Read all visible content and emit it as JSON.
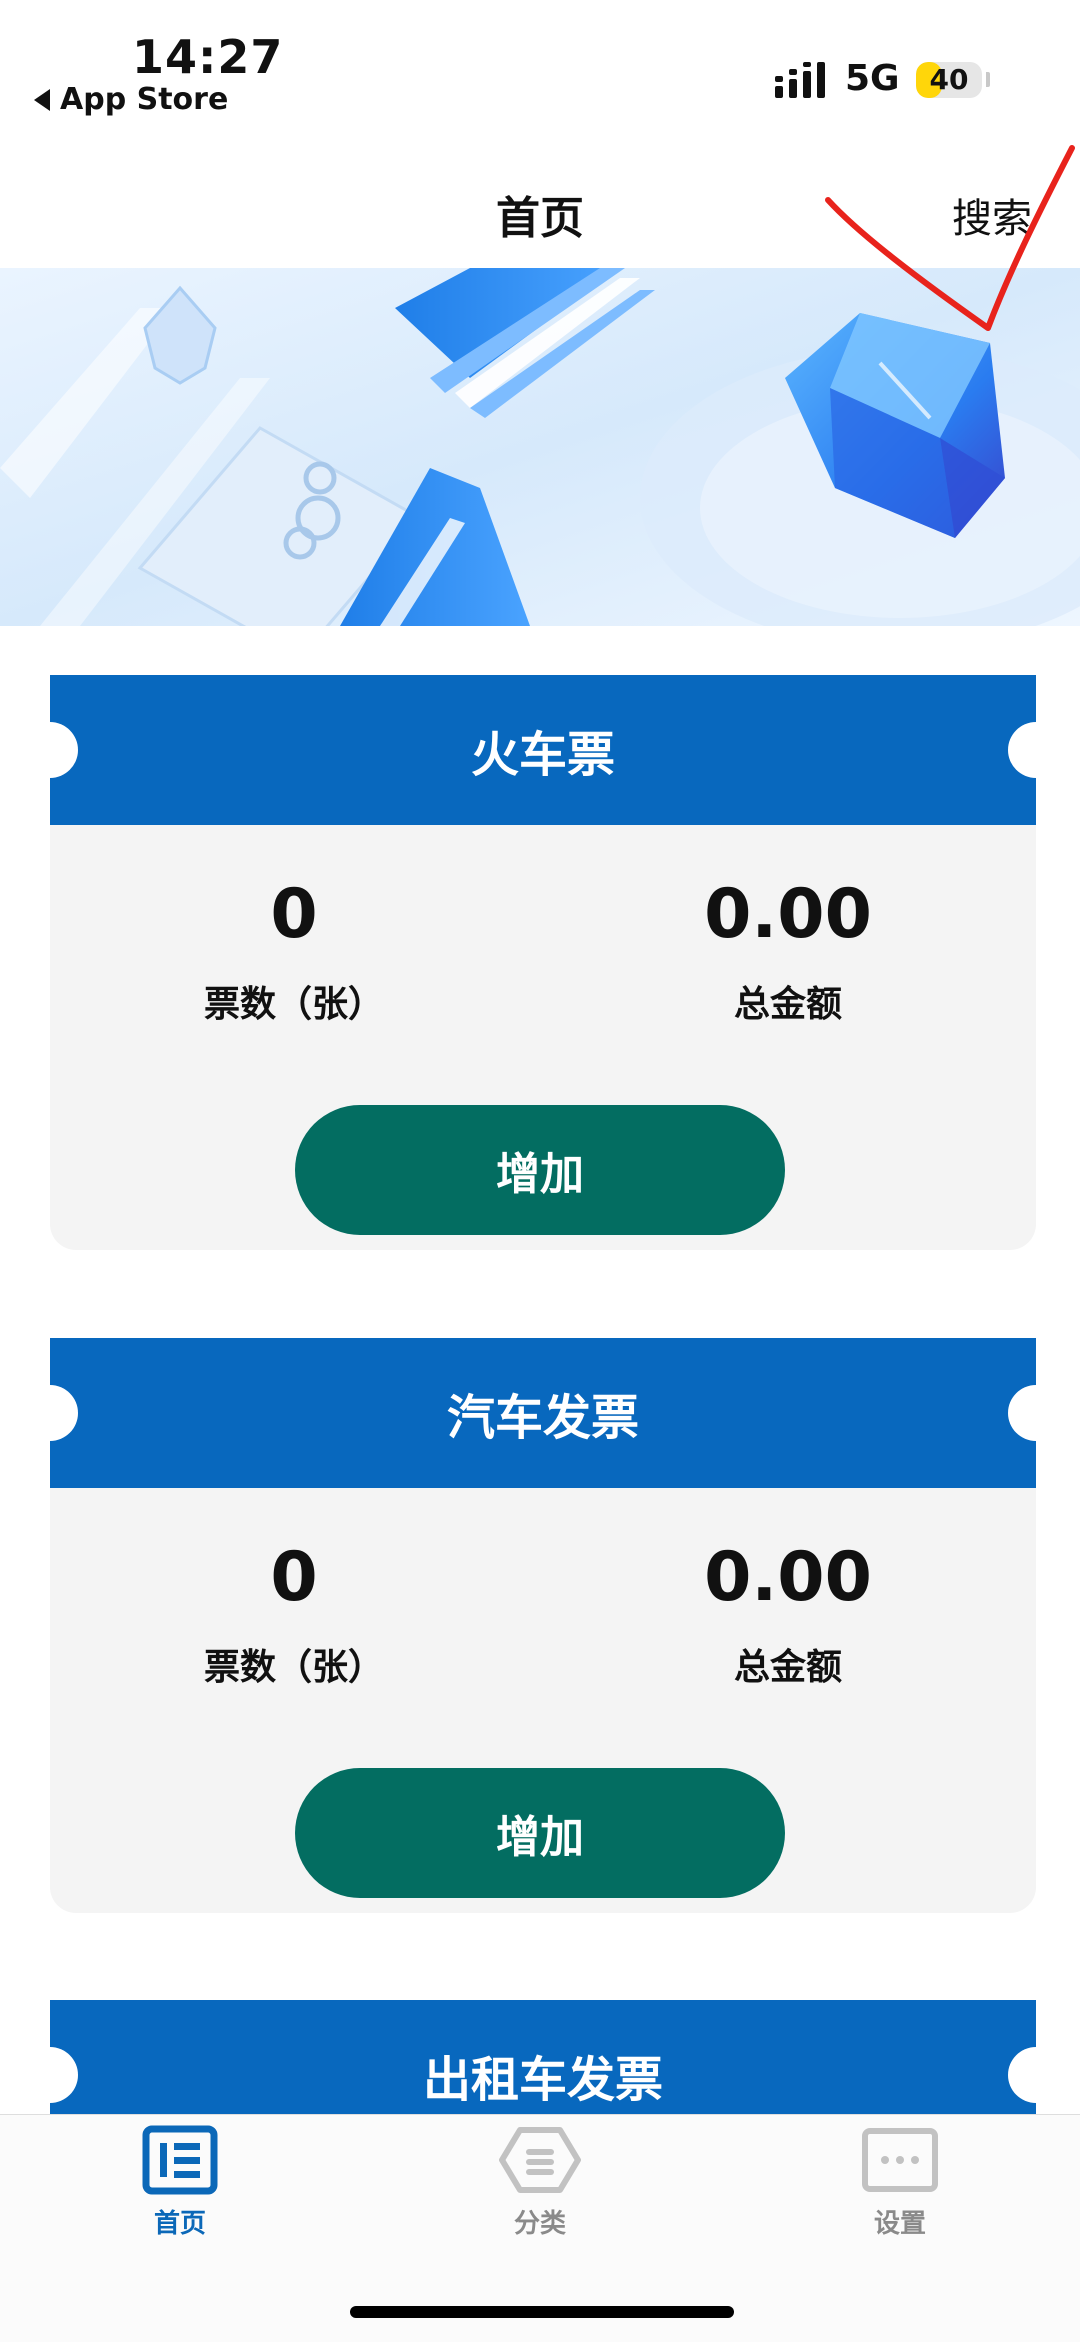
{
  "status_bar": {
    "time": "14:27",
    "back_label": "App Store",
    "network": "5G",
    "battery": "40",
    "battery_level": 0.4
  },
  "navbar": {
    "title": "首页",
    "search_label": "搜索"
  },
  "cards": [
    {
      "title": "火车票",
      "count_value": "0",
      "count_label": "票数（张）",
      "amount_value": "0.00",
      "amount_label": "总金额",
      "button_label": "增加"
    },
    {
      "title": "汽车发票",
      "count_value": "0",
      "count_label": "票数（张）",
      "amount_value": "0.00",
      "amount_label": "总金额",
      "button_label": "增加"
    },
    {
      "title": "出租车发票"
    }
  ],
  "tabbar": {
    "items": [
      {
        "label": "首页",
        "icon": "home-list-icon",
        "active": true
      },
      {
        "label": "分类",
        "icon": "category-hexagon-icon",
        "active": false
      },
      {
        "label": "设置",
        "icon": "settings-chat-icon",
        "active": false
      }
    ]
  },
  "colors": {
    "card_header": "#0868be",
    "add_button": "#036d61",
    "tab_active": "#0b68b8",
    "tab_inactive": "#8a8a8a",
    "annotation_stroke": "#e8231c"
  }
}
